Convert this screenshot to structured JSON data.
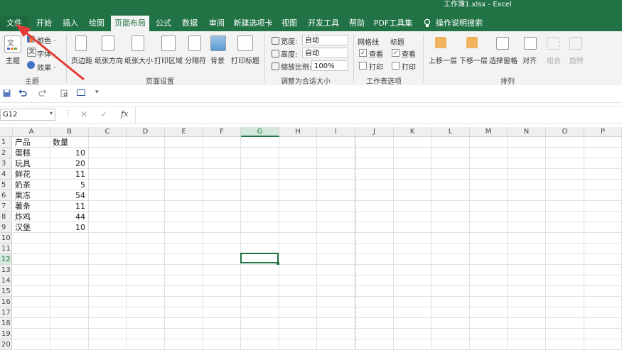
{
  "window": {
    "title": "工作簿1.xlsx  -  Excel"
  },
  "tabs": [
    {
      "label": "文件"
    },
    {
      "label": "开始"
    },
    {
      "label": "插入"
    },
    {
      "label": "绘图"
    },
    {
      "label": "页面布局"
    },
    {
      "label": "公式"
    },
    {
      "label": "数据"
    },
    {
      "label": "审阅"
    },
    {
      "label": "新建选项卡"
    },
    {
      "label": "视图"
    },
    {
      "label": "开发工具"
    },
    {
      "label": "帮助"
    },
    {
      "label": "PDF工具集"
    }
  ],
  "search": {
    "label": "操作说明搜索"
  },
  "ribbon": {
    "theme": {
      "themes": "主题",
      "colors": "颜色 ·",
      "fonts": "字体 ·",
      "effects": "效果 ·",
      "group": "主题"
    },
    "page_setup": {
      "margins": "页边距",
      "orientation": "纸张方向",
      "size": "纸张大小",
      "print_area": "打印区域",
      "breaks": "分隔符",
      "background": "背景",
      "print_titles": "打印标题",
      "group": "页面设置"
    },
    "scale": {
      "width_label": "宽度:",
      "width_value": "自动",
      "height_label": "高度:",
      "height_value": "自动",
      "scale_label": "缩放比例:",
      "scale_value": "100%",
      "group": "调整为合适大小"
    },
    "sheet_options": {
      "gridlines": "网格线",
      "headings": "标题",
      "view": "查看",
      "print": "打印",
      "group": "工作表选项"
    },
    "arrange": {
      "bring_forward": "上移一层",
      "send_backward": "下移一层",
      "selection_pane": "选择窗格",
      "align": "对齐",
      "group_btn": "组合",
      "rotate": "旋转",
      "group": "排列"
    }
  },
  "formula_bar": {
    "name_box": "G12",
    "fx": "fx"
  },
  "sheet": {
    "columns": [
      "A",
      "B",
      "C",
      "D",
      "E",
      "F",
      "G",
      "H",
      "I",
      "J",
      "K",
      "L",
      "M",
      "N",
      "O",
      "P"
    ],
    "rows": [
      "1",
      "2",
      "3",
      "4",
      "5",
      "6",
      "7",
      "8",
      "9",
      "10",
      "11",
      "12",
      "13",
      "14",
      "15",
      "16",
      "17",
      "18",
      "19",
      "20"
    ],
    "selected_column": "G",
    "selected_row": "12",
    "header_row": {
      "a": "产品",
      "b": "数量"
    },
    "data": [
      {
        "a": "蛋糕",
        "b": "10"
      },
      {
        "a": "玩具",
        "b": "20"
      },
      {
        "a": "鲜花",
        "b": "11"
      },
      {
        "a": "奶茶",
        "b": "5"
      },
      {
        "a": "果冻",
        "b": "54"
      },
      {
        "a": "薯条",
        "b": "11"
      },
      {
        "a": "炸鸡",
        "b": "44"
      },
      {
        "a": "汉堡",
        "b": "10"
      }
    ]
  },
  "colors": {
    "accent": "#217346",
    "annotation": "#e53935"
  }
}
